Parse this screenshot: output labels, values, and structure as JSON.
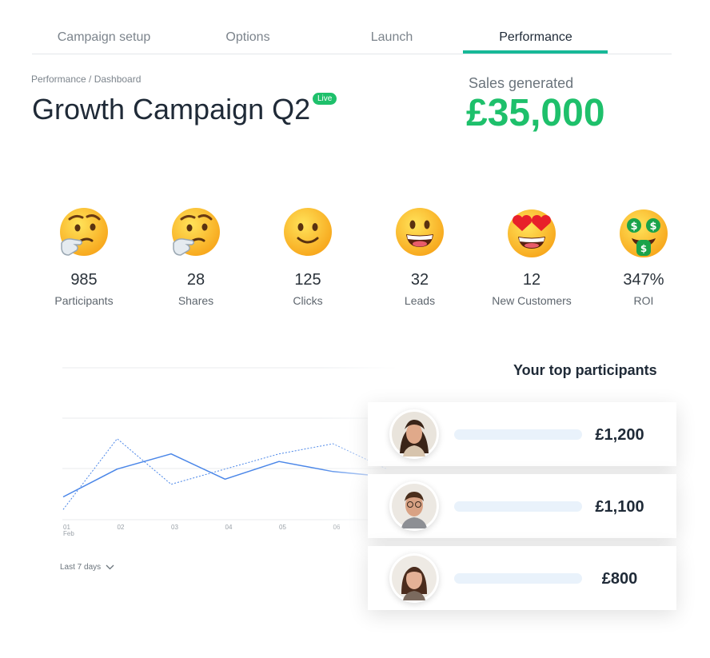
{
  "tabs": [
    {
      "label": "Campaign setup"
    },
    {
      "label": "Options"
    },
    {
      "label": "Launch"
    },
    {
      "label": "Performance",
      "active": true
    }
  ],
  "breadcrumb": "Performance / Dashboard",
  "campaign": {
    "title": "Growth Campaign Q2",
    "status": "Live"
  },
  "sales": {
    "label": "Sales generated",
    "value": "£35,000"
  },
  "stats": [
    {
      "icon": "thinking-face-icon",
      "value": "985",
      "label": "Participants"
    },
    {
      "icon": "thinking-face-icon",
      "value": "28",
      "label": "Shares"
    },
    {
      "icon": "slightly-smiling-face-icon",
      "value": "125",
      "label": "Clicks"
    },
    {
      "icon": "grinning-face-icon",
      "value": "32",
      "label": "Leads"
    },
    {
      "icon": "heart-eyes-face-icon",
      "value": "12",
      "label": "New Customers"
    },
    {
      "icon": "money-mouth-face-icon",
      "value": "347%",
      "label": "ROI"
    }
  ],
  "chart_data": {
    "type": "line",
    "x": [
      "01",
      "02",
      "03",
      "04",
      "05",
      "06"
    ],
    "x_sublabel": "Feb",
    "y_ticks": [
      "30",
      "10"
    ],
    "ylim": [
      0,
      30
    ],
    "series": [
      {
        "style": "solid",
        "values": [
          4.5,
          10,
          13,
          8,
          11.5,
          9.5,
          8.5
        ]
      },
      {
        "style": "dotted",
        "values": [
          2,
          16,
          7,
          10,
          13,
          15,
          10
        ]
      }
    ],
    "colors": {
      "line": "#4a86e8",
      "grid": "#e8ebee"
    }
  },
  "range_select": {
    "label": "Last 7 days"
  },
  "top_participants": {
    "title": "Your top participants",
    "items": [
      {
        "amount": "£1,200"
      },
      {
        "amount": "£1,100"
      },
      {
        "amount": "£800"
      }
    ]
  },
  "colors": {
    "accent": "#17b897",
    "success": "#1ec06b"
  }
}
